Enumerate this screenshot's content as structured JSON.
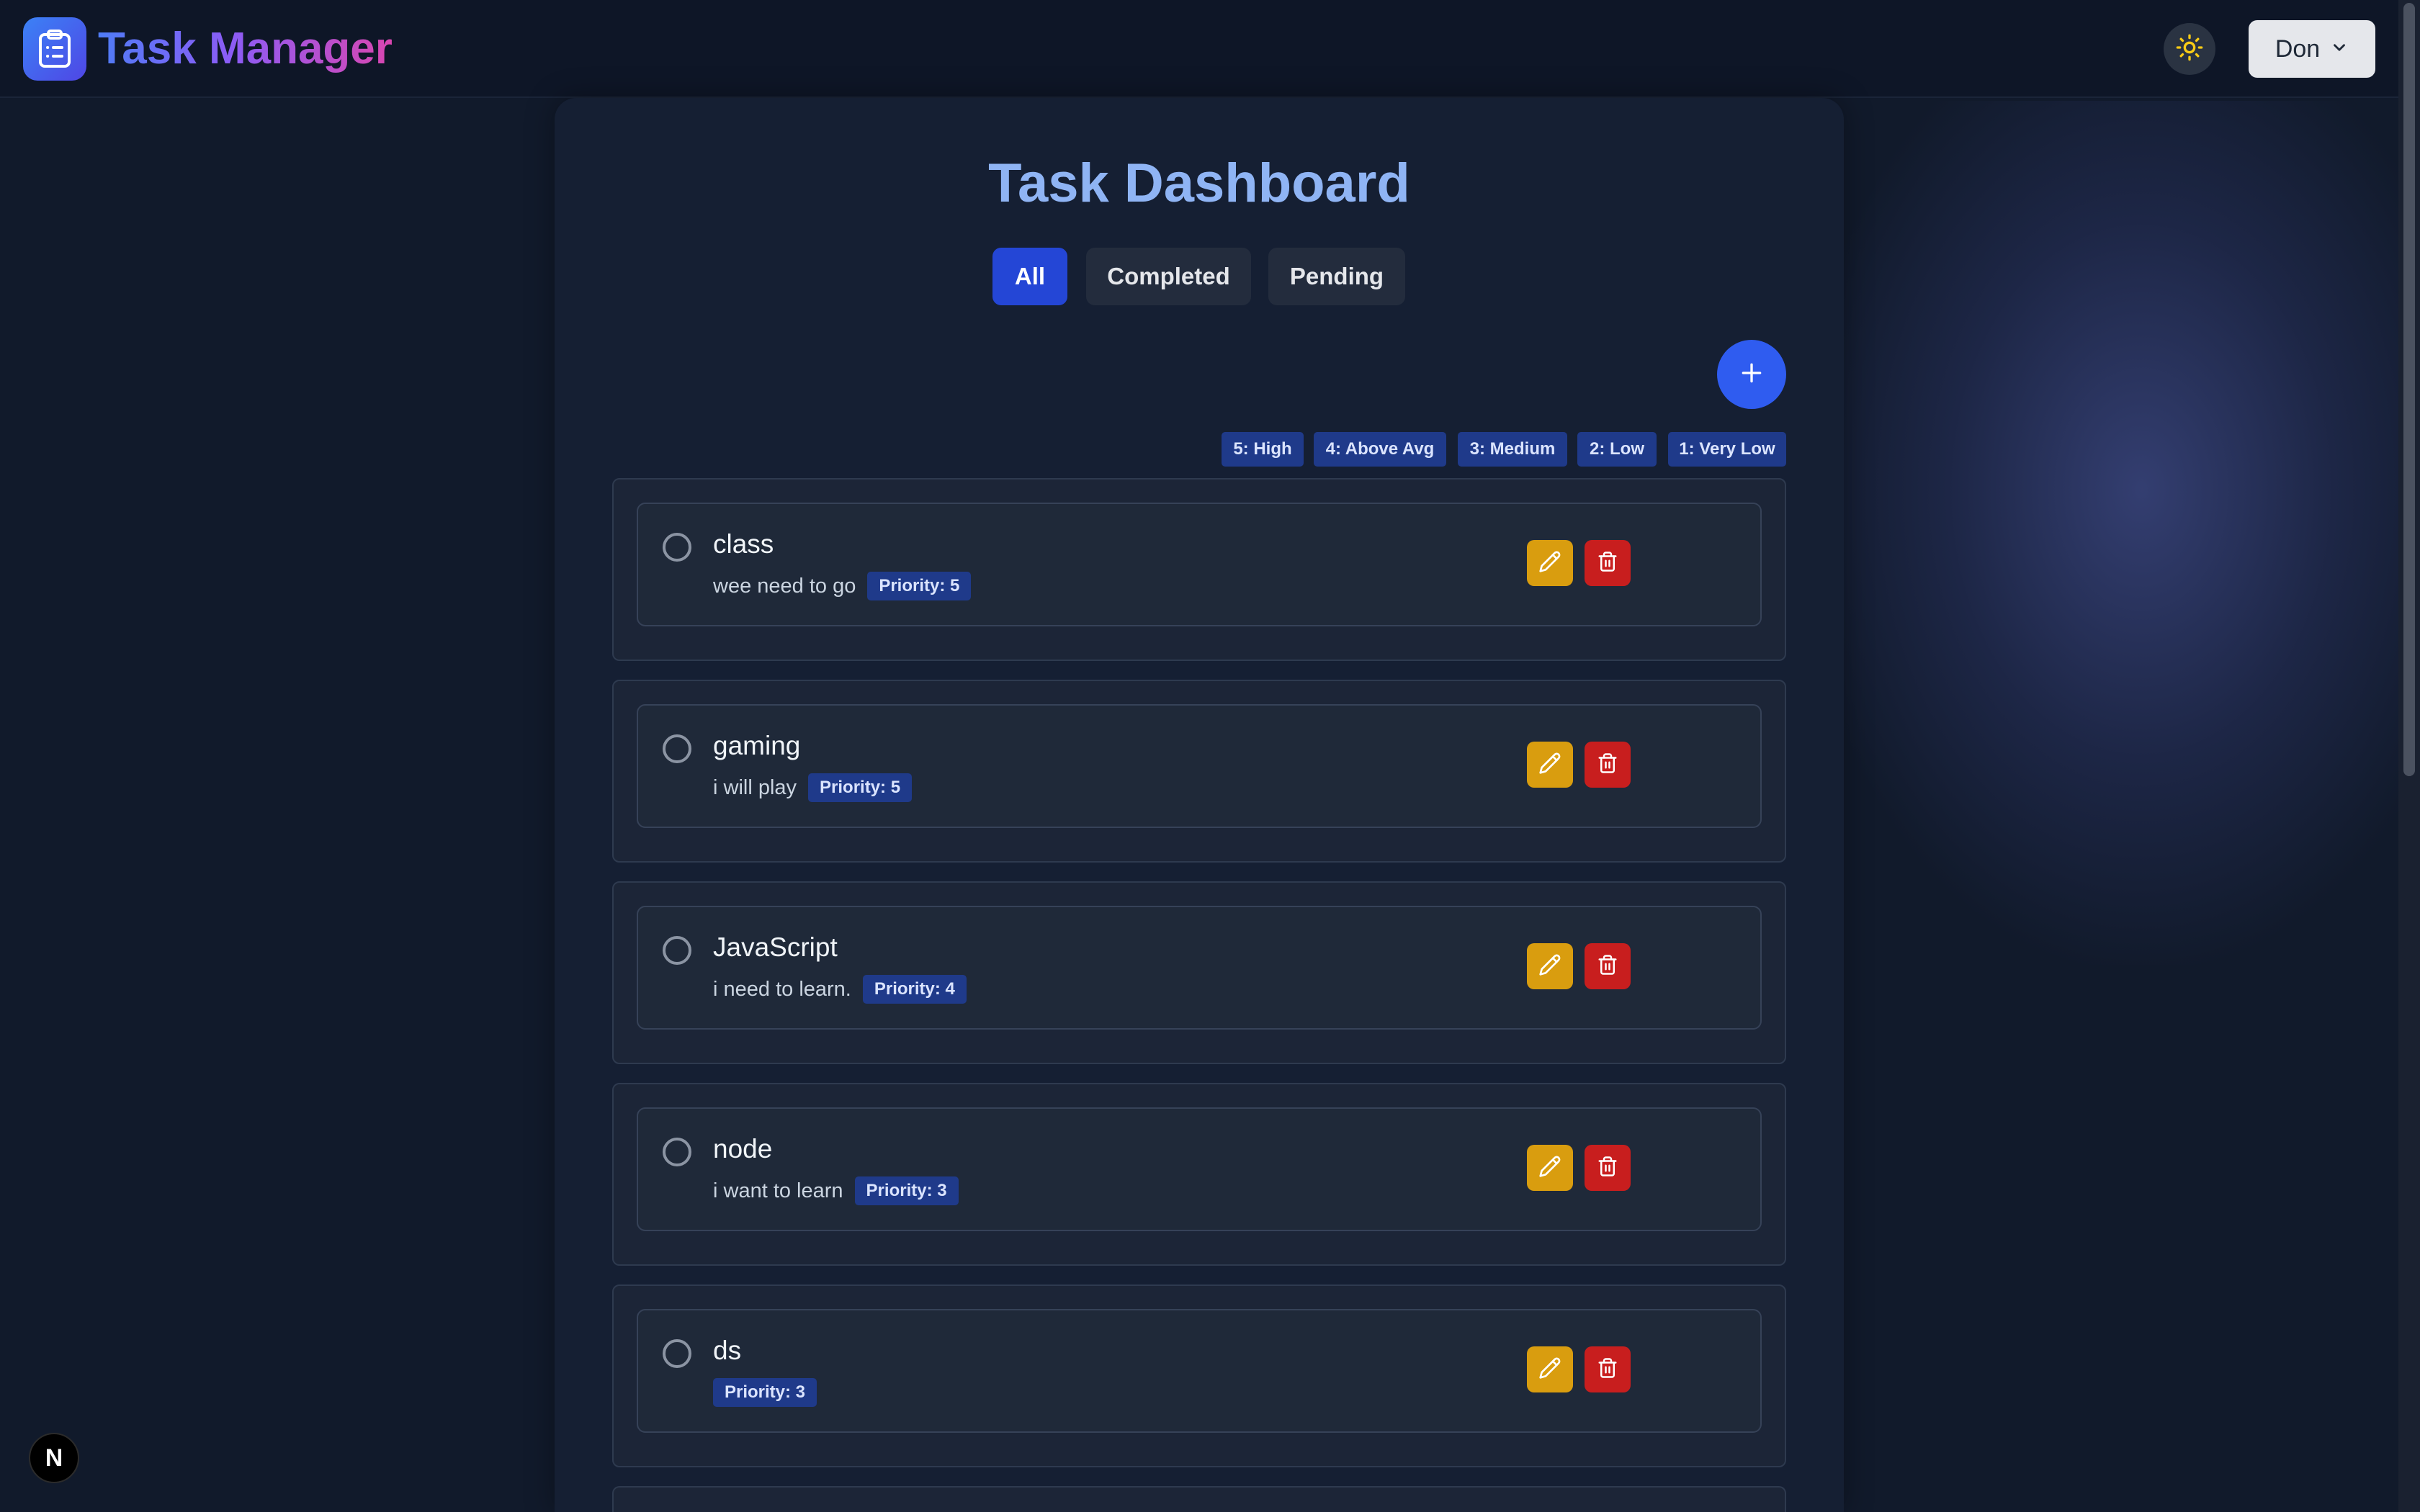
{
  "app": {
    "title": "Task Manager"
  },
  "header": {
    "user_name": "Don"
  },
  "page": {
    "title": "Task Dashboard"
  },
  "filters": [
    "All",
    "Completed",
    "Pending"
  ],
  "active_filter": "All",
  "priority_legend": [
    "5: High",
    "4: Above Avg",
    "3: Medium",
    "2: Low",
    "1: Very Low"
  ],
  "tasks": [
    {
      "title": "class",
      "description": "wee need to go",
      "priority": "Priority: 5",
      "completed": false
    },
    {
      "title": "gaming",
      "description": "i will play",
      "priority": "Priority: 5",
      "completed": false
    },
    {
      "title": "JavaScript",
      "description": "i need to learn.",
      "priority": "Priority: 4",
      "completed": false
    },
    {
      "title": "node",
      "description": "i want to learn",
      "priority": "Priority: 3",
      "completed": false
    },
    {
      "title": "ds",
      "description": "",
      "priority": "Priority: 3",
      "completed": false
    }
  ],
  "badge": {
    "letter": "N"
  },
  "colors": {
    "accent": "#2f5cf0",
    "edit": "#d99d0f",
    "delete": "#c81e1e",
    "priority_badge": "#1f3a8a"
  },
  "icons": {
    "logo": "clipboard-icon",
    "theme": "sun-icon",
    "user_menu": "chevron-down-icon",
    "add": "plus-icon",
    "edit": "pencil-icon",
    "delete": "trash-icon"
  }
}
